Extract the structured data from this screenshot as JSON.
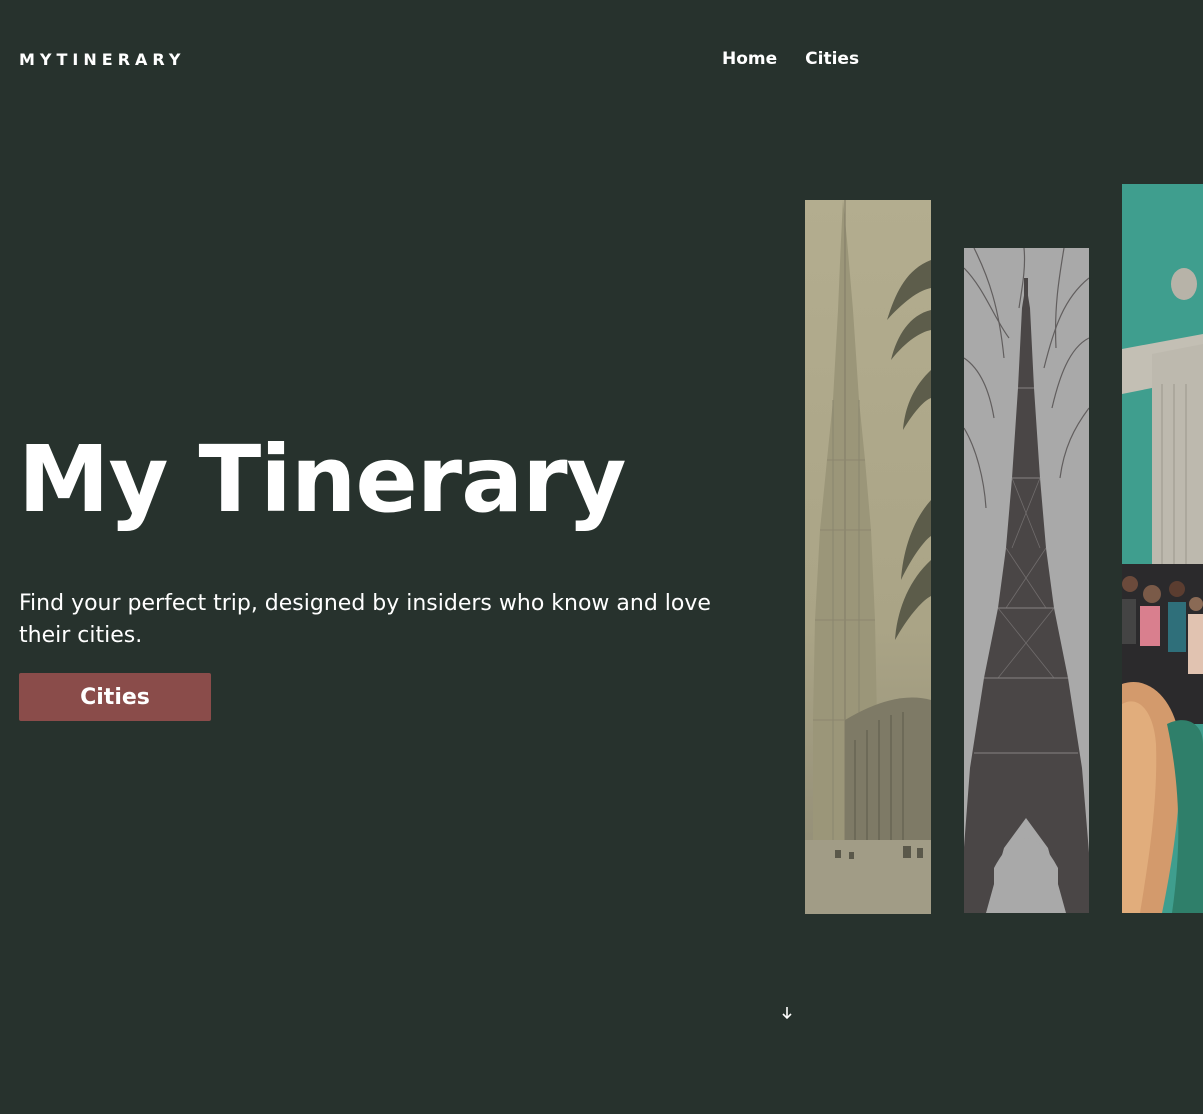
{
  "header": {
    "brand": "MYTINERARY",
    "nav": [
      {
        "label": "Home"
      },
      {
        "label": "Cities"
      }
    ]
  },
  "hero": {
    "title": "My Tinerary",
    "subtitle": "Find your perfect trip, designed by insiders who know and love their cities.",
    "cta_label": "Cities"
  },
  "gallery": {
    "images": [
      {
        "subject": "Burj Khalifa skyline with palm trees (sepia)"
      },
      {
        "subject": "Eiffel Tower through bare branches (grayscale)"
      },
      {
        "subject": "Christ the Redeemer statue with crowd of tourists"
      }
    ]
  },
  "scroll_indicator": {
    "icon": "arrow-down-icon"
  },
  "colors": {
    "background": "#27322d",
    "text": "#ffffff",
    "accent_button": "#8a4c4a"
  }
}
